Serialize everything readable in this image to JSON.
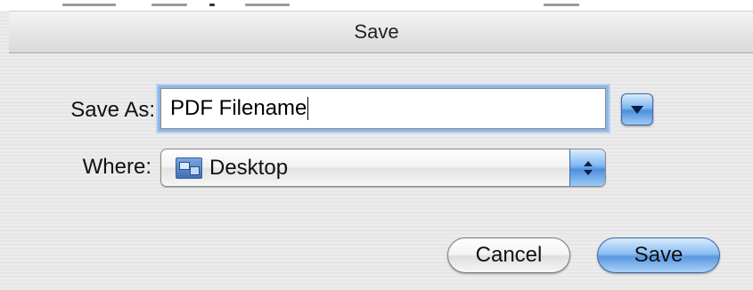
{
  "dialog": {
    "title": "Save"
  },
  "form": {
    "save_as_label": "Save As:",
    "filename_value": "PDF Filename",
    "where_label": "Where:",
    "where_value": "Desktop",
    "where_icon": "desktop-folder-icon"
  },
  "buttons": {
    "cancel_label": "Cancel",
    "save_label": "Save"
  },
  "colors": {
    "accent_blue": "#5a98e0",
    "focus_ring": "#8db6e6"
  }
}
